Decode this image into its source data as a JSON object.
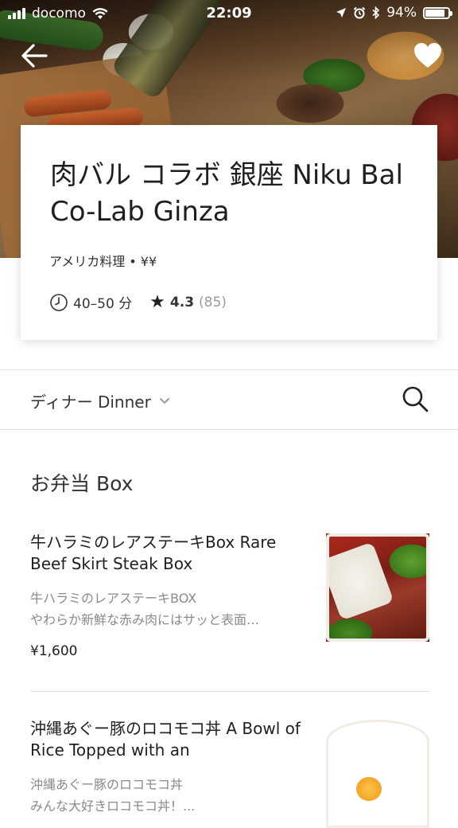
{
  "status_bar": {
    "carrier": "docomo",
    "time": "22:09",
    "battery": "94%",
    "battery_level": 0.94
  },
  "restaurant": {
    "name": "肉バル コラボ 銀座 Niku Bal Co-Lab Ginza",
    "category_price": "アメリカ料理 • ¥¥",
    "delivery_time": "40–50 分",
    "rating": "4.3",
    "rating_count": "(85)"
  },
  "menu": {
    "selected": "ディナー Dinner"
  },
  "section": {
    "title": "お弁当 Box"
  },
  "items": [
    {
      "name": "牛ハラミのレアステーキBox Rare Beef Skirt Steak Box",
      "desc_line1": "牛ハラミのレアステーキBOX",
      "desc_line2": "やわらか新鮮な赤み肉にはサッと表面…",
      "price": "¥1,600"
    },
    {
      "name": "沖縄あぐー豚のロコモコ丼 A Bowl of Rice Topped with an",
      "desc_line1": "沖縄あぐー豚のロコモコ丼",
      "desc_line2": "みんな大好きロコモコ丼！..."
    }
  ],
  "icons": {
    "back": "arrow-left-icon",
    "favorite": "heart-icon",
    "clock": "clock-icon",
    "star": "star-icon",
    "search": "search-icon",
    "chevron": "chevron-down-icon"
  },
  "colors": {
    "text": "#1f1f1f",
    "muted": "#8a8a8a",
    "divider": "#e2e2e2"
  }
}
